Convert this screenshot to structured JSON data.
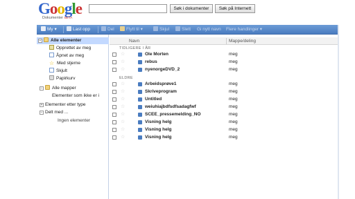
{
  "header": {
    "logo_text": [
      "G",
      "o",
      "o",
      "g",
      "l",
      "e"
    ],
    "logo_sub": "Dokumenter",
    "logo_beta": "BETA",
    "search_value": "",
    "btn_search_docs": "Søk i dokumenter",
    "btn_search_web": "Søk på Internett"
  },
  "toolbar": {
    "new": "My",
    "upload": "Last opp",
    "share": "Del",
    "move": "Flytt til",
    "hide": "Skjul",
    "delete": "Slett",
    "rename": "Gi nytt navn",
    "more": "Flere handlinger"
  },
  "nav": {
    "all_items": "Alle elementer",
    "created_by_me": "Opprettet av meg",
    "opened_by_me": "Åpnet av meg",
    "starred": "Med stjerne",
    "hidden": "Skjult",
    "trash": "Papirkurv",
    "all_folders": "Alle mapper",
    "not_in_folders": "Elementer som ikke er i",
    "items_by_type": "Elementer etter type",
    "shared_with": "Delt med ...",
    "no_items": "Ingen elementer"
  },
  "list": {
    "col_name": "Navn",
    "col_share": "Mappe/deling",
    "group_earlier_year": "TIDLIGERE I ÅR",
    "group_older": "ELDRE",
    "earlier_files": [
      {
        "name": "Ole Morten",
        "share": "meg"
      },
      {
        "name": "rebus",
        "share": "meg"
      },
      {
        "name": "nyenorgeDVD_2",
        "share": "meg"
      }
    ],
    "older_files": [
      {
        "name": "Arbeidsprøve1",
        "share": "meg"
      },
      {
        "name": "Skriveprogram",
        "share": "meg"
      },
      {
        "name": "Untitled",
        "share": "meg"
      },
      {
        "name": "weiuhiajbdfsdfsadagfwf",
        "share": "meg"
      },
      {
        "name": "SCEE_pressemelding_NO",
        "share": "meg"
      },
      {
        "name": "Visning helg",
        "share": "meg"
      },
      {
        "name": "Visning helg",
        "share": "meg"
      },
      {
        "name": "Visning helg",
        "share": "meg"
      }
    ]
  },
  "colors": {
    "toolbar": "#4a7cc0",
    "selected_nav": "#c3d9ff",
    "doc_icon": "#4a7cc0"
  }
}
